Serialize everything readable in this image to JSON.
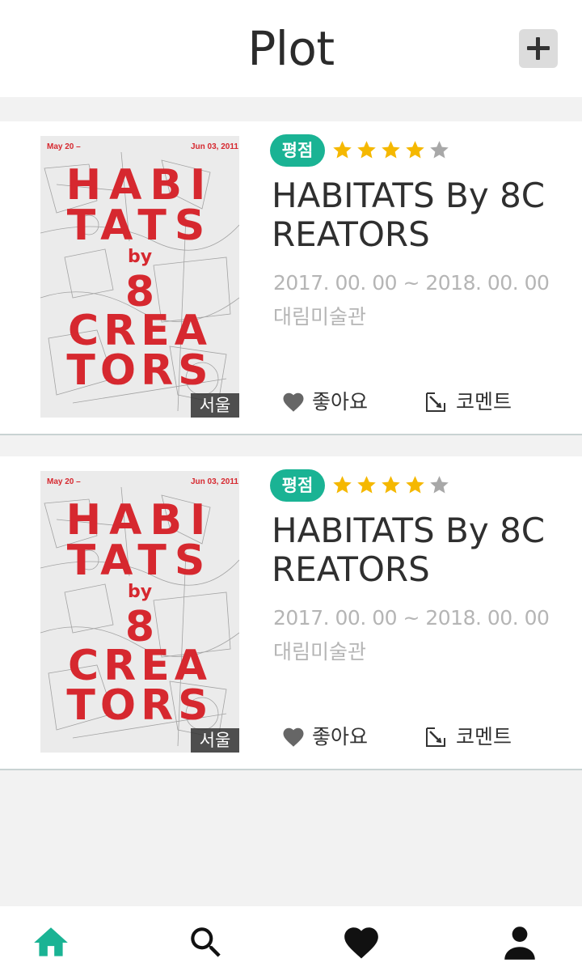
{
  "header": {
    "title": "Plot",
    "add_icon": "plus-icon"
  },
  "exhibitions": [
    {
      "poster": {
        "date_start": "May 20 –",
        "date_end": "Jun 03, 2011",
        "headline_lines": [
          "HABI",
          "TATS",
          "by",
          "8",
          "CREA",
          "TORS"
        ],
        "region": "서울"
      },
      "rating_label": "평점",
      "rating": 4,
      "rating_max": 5,
      "title": "HABITATS By 8CREATORS",
      "period": "2017. 00. 00 ~ 2018. 00. 00",
      "venue": "대림미술관",
      "like_label": "좋아요",
      "comment_label": "코멘트"
    },
    {
      "poster": {
        "date_start": "May 20 –",
        "date_end": "Jun 03, 2011",
        "headline_lines": [
          "HABI",
          "TATS",
          "by",
          "8",
          "CREA",
          "TORS"
        ],
        "region": "서울"
      },
      "rating_label": "평점",
      "rating": 4,
      "rating_max": 5,
      "title": "HABITATS By 8CREATORS",
      "period": "2017. 00. 00 ~ 2018. 00. 00",
      "venue": "대림미술관",
      "like_label": "좋아요",
      "comment_label": "코멘트"
    }
  ],
  "nav": {
    "items": [
      {
        "icon": "home-icon",
        "active": true
      },
      {
        "icon": "search-icon",
        "active": false
      },
      {
        "icon": "heart-icon",
        "active": false
      },
      {
        "icon": "user-icon",
        "active": false
      }
    ],
    "active_color": "#1ab394",
    "inactive_color": "#111111"
  },
  "colors": {
    "accent": "#1ab394",
    "star_on": "#f5b800",
    "star_off": "#a8a8a8",
    "poster_red": "#d6282f"
  }
}
